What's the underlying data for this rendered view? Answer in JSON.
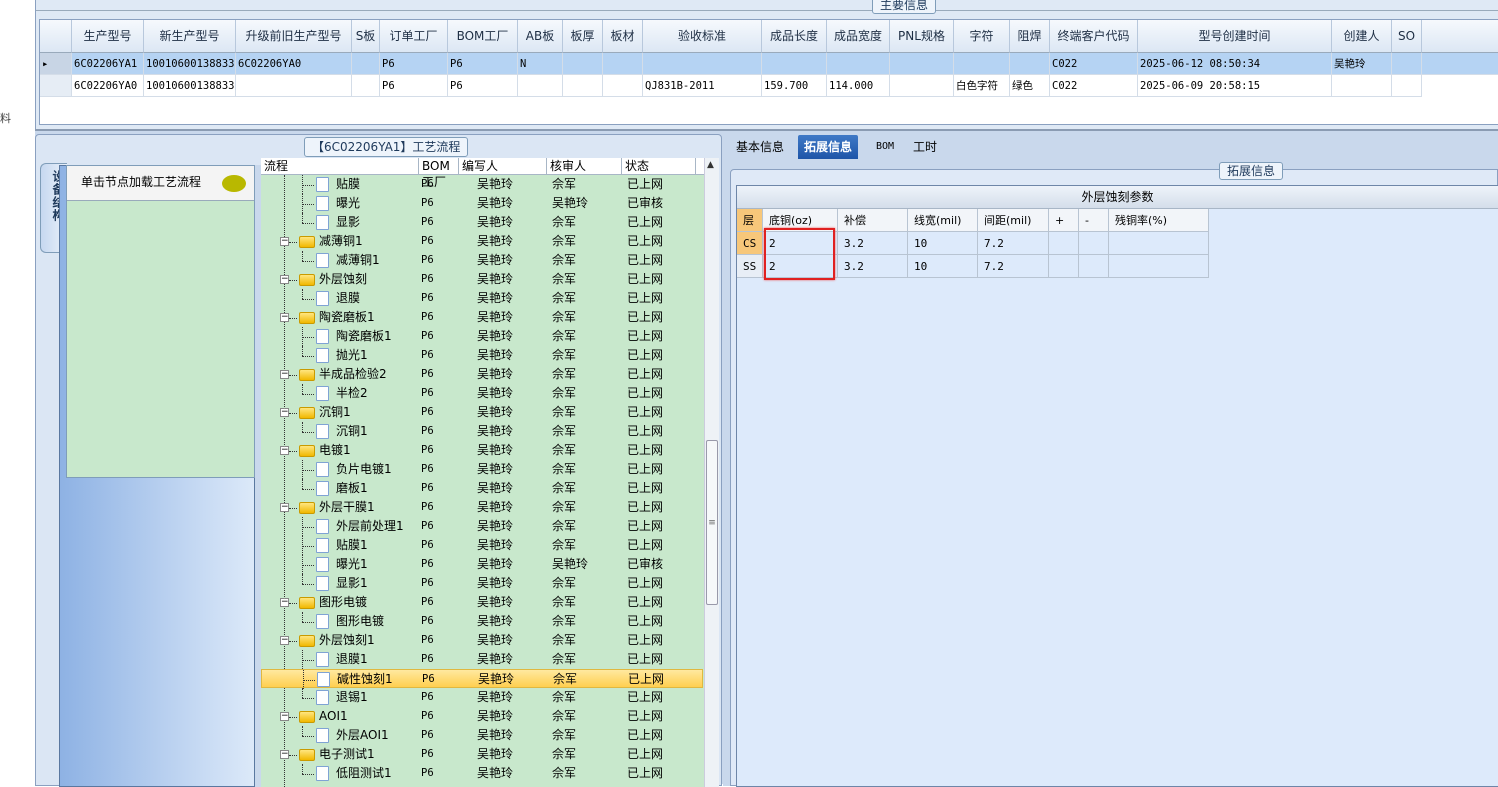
{
  "side_label": "料",
  "main_info": {
    "title": "主要信息",
    "columns": [
      "生产型号",
      "新生产型号",
      "升级前旧生产型号",
      "S板",
      "订单工厂",
      "BOM工厂",
      "AB板",
      "板厚",
      "板材",
      "验收标准",
      "成品长度",
      "成品宽度",
      "PNL规格",
      "字符",
      "阻焊",
      "终端客户代码",
      "型号创建时间",
      "创建人",
      "SO"
    ],
    "rows": [
      [
        "6C02206YA1",
        "10010600138833",
        "6C02206YA0",
        "",
        "P6",
        "P6",
        "N",
        "",
        "",
        "",
        "",
        "",
        "",
        "",
        "",
        "C022",
        "2025-06-12 08:50:34",
        "吴艳玲",
        ""
      ],
      [
        "6C02206YA0",
        "10010600138833",
        "",
        "",
        "P6",
        "P6",
        "",
        "",
        "",
        "QJ831B-2011",
        "159.700",
        "114.000",
        "",
        "白色字符",
        "绿色",
        "C022",
        "2025-06-09 20:58:15",
        "",
        ""
      ]
    ],
    "selected_row": 0
  },
  "process": {
    "title": "【6C02206YA1】工艺流程",
    "vertical_tab": "设备结构",
    "node_hint": "单击节点加载工艺流程",
    "columns": [
      "流程",
      "BOM工厂",
      "编写人",
      "核审人",
      "状态"
    ],
    "rows": [
      {
        "lv": 2,
        "name": "贴膜",
        "bom": "P6",
        "writer": "吴艳玲",
        "reviewer": "佘军",
        "status": "已上网"
      },
      {
        "lv": 2,
        "name": "曝光",
        "bom": "P6",
        "writer": "吴艳玲",
        "reviewer": "吴艳玲",
        "status": "已审核"
      },
      {
        "lv": 2,
        "name": "显影",
        "bom": "P6",
        "writer": "吴艳玲",
        "reviewer": "佘军",
        "status": "已上网"
      },
      {
        "lv": 1,
        "name": "减薄铜1",
        "bom": "P6",
        "writer": "吴艳玲",
        "reviewer": "佘军",
        "status": "已上网"
      },
      {
        "lv": 2,
        "name": "减薄铜1",
        "bom": "P6",
        "writer": "吴艳玲",
        "reviewer": "佘军",
        "status": "已上网"
      },
      {
        "lv": 1,
        "name": "外层蚀刻",
        "bom": "P6",
        "writer": "吴艳玲",
        "reviewer": "佘军",
        "status": "已上网"
      },
      {
        "lv": 2,
        "name": "退膜",
        "bom": "P6",
        "writer": "吴艳玲",
        "reviewer": "佘军",
        "status": "已上网"
      },
      {
        "lv": 1,
        "name": "陶瓷磨板1",
        "bom": "P6",
        "writer": "吴艳玲",
        "reviewer": "佘军",
        "status": "已上网"
      },
      {
        "lv": 2,
        "name": "陶瓷磨板1",
        "bom": "P6",
        "writer": "吴艳玲",
        "reviewer": "佘军",
        "status": "已上网"
      },
      {
        "lv": 2,
        "name": "抛光1",
        "bom": "P6",
        "writer": "吴艳玲",
        "reviewer": "佘军",
        "status": "已上网"
      },
      {
        "lv": 1,
        "name": "半成品检验2",
        "bom": "P6",
        "writer": "吴艳玲",
        "reviewer": "佘军",
        "status": "已上网"
      },
      {
        "lv": 2,
        "name": "半检2",
        "bom": "P6",
        "writer": "吴艳玲",
        "reviewer": "佘军",
        "status": "已上网"
      },
      {
        "lv": 1,
        "name": "沉铜1",
        "bom": "P6",
        "writer": "吴艳玲",
        "reviewer": "佘军",
        "status": "已上网"
      },
      {
        "lv": 2,
        "name": "沉铜1",
        "bom": "P6",
        "writer": "吴艳玲",
        "reviewer": "佘军",
        "status": "已上网"
      },
      {
        "lv": 1,
        "name": "电镀1",
        "bom": "P6",
        "writer": "吴艳玲",
        "reviewer": "佘军",
        "status": "已上网"
      },
      {
        "lv": 2,
        "name": "负片电镀1",
        "bom": "P6",
        "writer": "吴艳玲",
        "reviewer": "佘军",
        "status": "已上网"
      },
      {
        "lv": 2,
        "name": "磨板1",
        "bom": "P6",
        "writer": "吴艳玲",
        "reviewer": "佘军",
        "status": "已上网"
      },
      {
        "lv": 1,
        "name": "外层干膜1",
        "bom": "P6",
        "writer": "吴艳玲",
        "reviewer": "佘军",
        "status": "已上网"
      },
      {
        "lv": 2,
        "name": "外层前处理1",
        "bom": "P6",
        "writer": "吴艳玲",
        "reviewer": "佘军",
        "status": "已上网"
      },
      {
        "lv": 2,
        "name": "贴膜1",
        "bom": "P6",
        "writer": "吴艳玲",
        "reviewer": "佘军",
        "status": "已上网"
      },
      {
        "lv": 2,
        "name": "曝光1",
        "bom": "P6",
        "writer": "吴艳玲",
        "reviewer": "吴艳玲",
        "status": "已审核"
      },
      {
        "lv": 2,
        "name": "显影1",
        "bom": "P6",
        "writer": "吴艳玲",
        "reviewer": "佘军",
        "status": "已上网"
      },
      {
        "lv": 1,
        "name": "图形电镀",
        "bom": "P6",
        "writer": "吴艳玲",
        "reviewer": "佘军",
        "status": "已上网"
      },
      {
        "lv": 2,
        "name": "图形电镀",
        "bom": "P6",
        "writer": "吴艳玲",
        "reviewer": "佘军",
        "status": "已上网"
      },
      {
        "lv": 1,
        "name": "外层蚀刻1",
        "bom": "P6",
        "writer": "吴艳玲",
        "reviewer": "佘军",
        "status": "已上网"
      },
      {
        "lv": 2,
        "name": "退膜1",
        "bom": "P6",
        "writer": "吴艳玲",
        "reviewer": "佘军",
        "status": "已上网"
      },
      {
        "lv": 2,
        "name": "碱性蚀刻1",
        "bom": "P6",
        "writer": "吴艳玲",
        "reviewer": "佘军",
        "status": "已上网",
        "selected": true
      },
      {
        "lv": 2,
        "name": "退锡1",
        "bom": "P6",
        "writer": "吴艳玲",
        "reviewer": "佘军",
        "status": "已上网"
      },
      {
        "lv": 1,
        "name": "AOI1",
        "bom": "P6",
        "writer": "吴艳玲",
        "reviewer": "佘军",
        "status": "已上网"
      },
      {
        "lv": 2,
        "name": "外层AOI1",
        "bom": "P6",
        "writer": "吴艳玲",
        "reviewer": "佘军",
        "status": "已上网"
      },
      {
        "lv": 1,
        "name": "电子测试1",
        "bom": "P6",
        "writer": "吴艳玲",
        "reviewer": "佘军",
        "status": "已上网"
      },
      {
        "lv": 2,
        "name": "低阻测试1",
        "bom": "P6",
        "writer": "吴艳玲",
        "reviewer": "佘军",
        "status": "已上网"
      }
    ]
  },
  "detail_tabs": [
    "基本信息",
    "拓展信息",
    "BOM",
    "工时"
  ],
  "active_tab": 1,
  "ext_info": {
    "group_title": "拓展信息",
    "table_title": "外层蚀刻参数",
    "columns": [
      "层",
      "底铜(oz)",
      "补偿",
      "线宽(mil)",
      "间距(mil)",
      "+",
      "-",
      "残铜率(%)"
    ],
    "rows": [
      [
        "CS",
        "2",
        "3.2",
        "10",
        "7.2",
        "",
        "",
        ""
      ],
      [
        "SS",
        "2",
        "3.2",
        "10",
        "7.2",
        "",
        "",
        ""
      ]
    ],
    "highlight_color": "#e02020"
  }
}
